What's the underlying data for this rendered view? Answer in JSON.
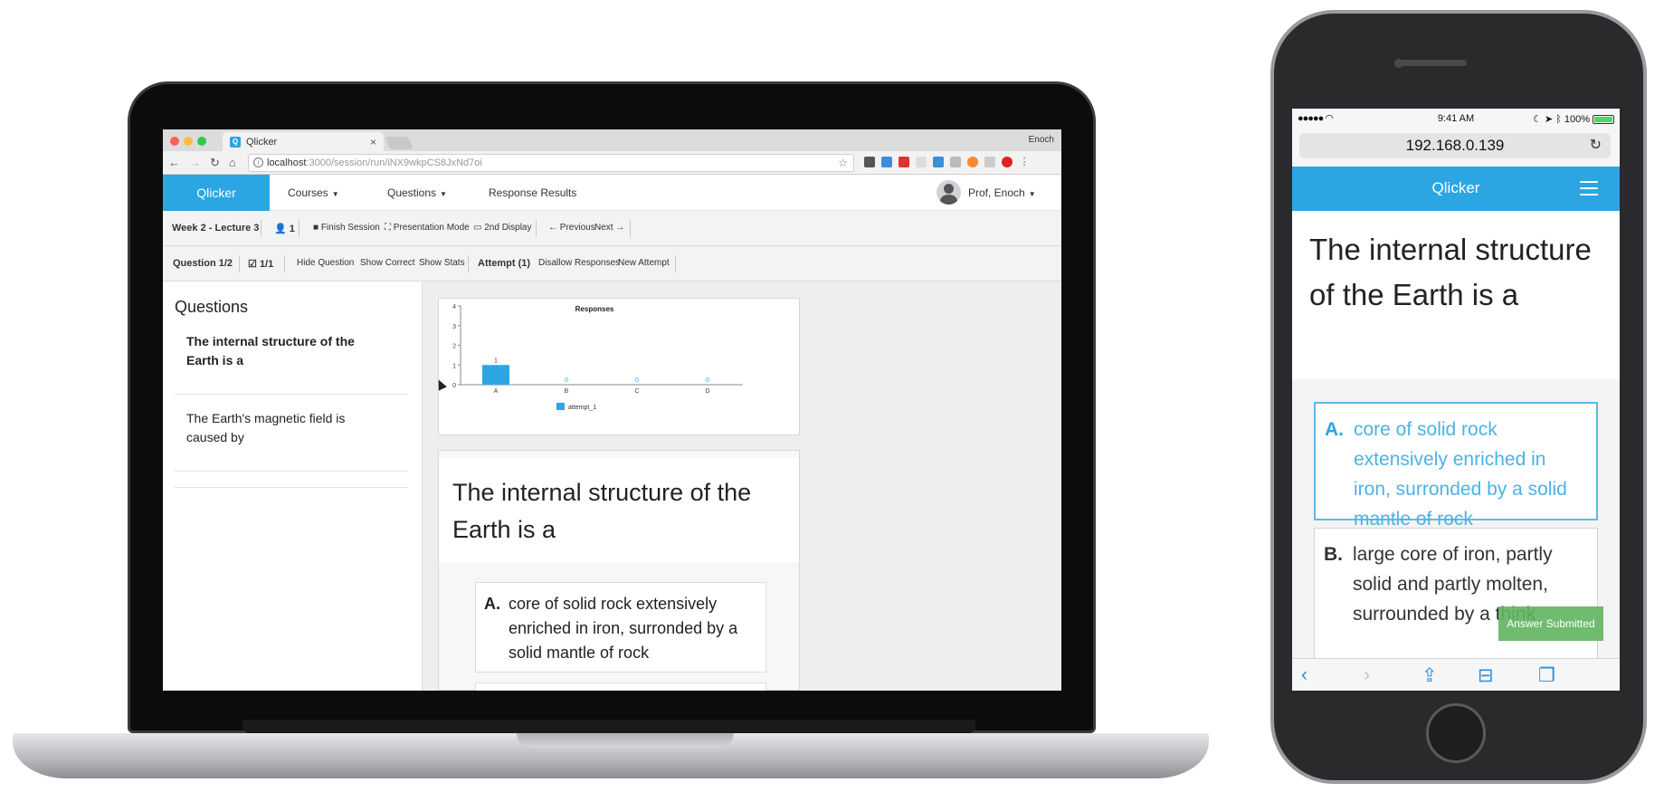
{
  "browser": {
    "tab_title": "Qlicker",
    "tab_favicon": "Q",
    "window_user": "Enoch",
    "url_host": "localhost",
    "url_rest": ":3000/session/run/iNX9wkpCS8JxNd7oi",
    "tab_close": "×"
  },
  "app": {
    "brand": "Qlicker",
    "nav": {
      "courses": "Courses",
      "questions": "Questions",
      "response_results": "Response Results",
      "profile": "Prof, Enoch"
    }
  },
  "session_bar": {
    "lecture": "Week 2 - Lecture 3",
    "participants": "1",
    "finish": "Finish Session",
    "presentation": "Presentation Mode",
    "second_display": "2nd Display",
    "previous": "Previous",
    "next": "Next"
  },
  "question_bar": {
    "question": "Question 1/2",
    "responses": "1/1",
    "hide": "Hide Question",
    "show_correct": "Show Correct",
    "show_stats": "Show Stats",
    "attempt": "Attempt (1)",
    "disallow": "Disallow Responses",
    "new_attempt": "New Attempt"
  },
  "sidebar": {
    "title": "Questions",
    "items": [
      {
        "text": "The internal structure of the Earth is a",
        "active": true
      },
      {
        "text": "The Earth's magnetic field is caused by",
        "active": false
      }
    ]
  },
  "question": {
    "title": "The internal structure of the Earth is a",
    "options": [
      {
        "letter": "A.",
        "text": "core of solid rock extensively enriched in iron, surronded by a solid mantle of rock"
      }
    ]
  },
  "chart_data": {
    "type": "bar",
    "title": "Responses",
    "categories": [
      "A",
      "B",
      "C",
      "D"
    ],
    "series": [
      {
        "name": "attempt_1",
        "values": [
          1,
          0,
          0,
          0
        ]
      }
    ],
    "ylim": [
      0,
      4
    ],
    "yticks": [
      "0",
      "1",
      "2",
      "3",
      "4"
    ],
    "xlabel": "",
    "ylabel": "",
    "legend": "bottom",
    "color": "#2ba6e3"
  },
  "phone": {
    "time": "9:41 AM",
    "battery": "100%",
    "url": "192.168.0.139",
    "brand": "Qlicker",
    "title": "The internal structure of the Earth is a",
    "options": [
      {
        "letter": "A.",
        "text": "core of solid rock extensively enriched in iron, surronded by a solid mantle of rock"
      },
      {
        "letter": "B.",
        "text": "large core of iron, partly solid and partly molten, surrounded by a think"
      }
    ],
    "toast": "Answer Submitted"
  },
  "colors": {
    "brand_blue": "#2ba6e3",
    "toast_green": "#60b460"
  }
}
